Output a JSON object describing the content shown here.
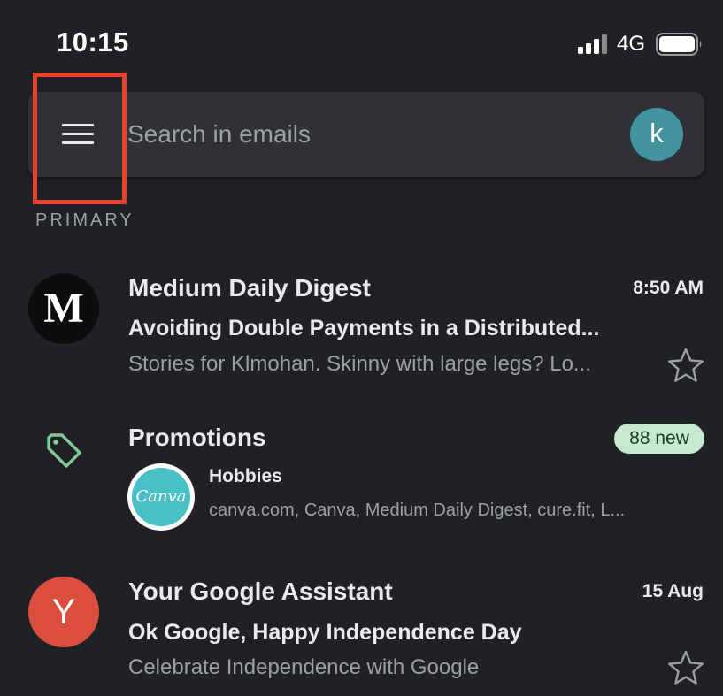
{
  "status_bar": {
    "time": "10:15",
    "network": "4G"
  },
  "search": {
    "placeholder": "Search in emails",
    "account_initial": "k"
  },
  "section_label": "PRIMARY",
  "emails": [
    {
      "avatar": "M",
      "sender": "Medium Daily Digest",
      "time": "8:50 AM",
      "subject": "Avoiding Double Payments in a Distributed...",
      "snippet": "Stories for Klmohan. Skinny with large legs? Lo..."
    },
    {
      "avatar": "Y",
      "sender": "Your Google Assistant",
      "time": "15 Aug",
      "subject": "Ok Google, Happy Independence Day",
      "snippet": "Celebrate Independence with Google"
    }
  ],
  "promotions": {
    "title": "Promotions",
    "badge": "88 new",
    "logo_text": "Canva",
    "subject": "Hobbies",
    "senders": "canva.com, Canva, Medium Daily Digest, cure.fit, L..."
  },
  "colors": {
    "background": "#202124",
    "search_bar": "#303134",
    "account_avatar": "#42939d",
    "highlight": "#e8412c",
    "badge_background": "#c7e9cf",
    "canva_brand": "#48c0c6",
    "assistant_avatar": "#db4d3c"
  },
  "icons": {
    "menu": "hamburger-menu-icon",
    "signal": "signal-bars-icon",
    "battery": "battery-icon",
    "tag": "tag-icon",
    "star": "star-outline-icon"
  }
}
